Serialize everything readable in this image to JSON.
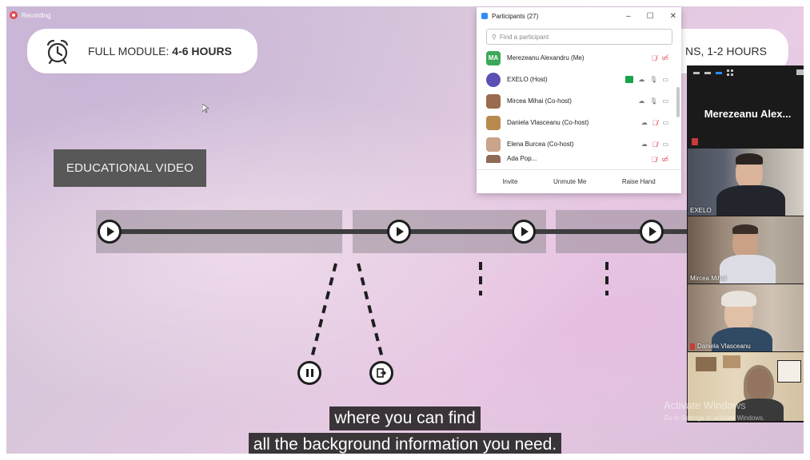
{
  "recording": {
    "label": "Recording"
  },
  "slide": {
    "pill_left": {
      "prefix": "FULL MODULE:",
      "value": "4-6 HOURS"
    },
    "pill_right": {
      "text": "NS, 1-2 HOURS"
    },
    "edu_label": "EDUCATIONAL VIDEO"
  },
  "captions": {
    "line1": "where you can find",
    "line2": "all the background information you need."
  },
  "participants": {
    "title": "Participants (27)",
    "search_placeholder": "Find a participant",
    "rows": [
      {
        "initials": "MA",
        "name": "Merezeanu Alexandru (Me)",
        "avatar_color": "#3aa857",
        "mic": "muted",
        "video": "off"
      },
      {
        "initials": "",
        "name": "EXELO (Host)",
        "avatar_color": "#5b4fb3",
        "mic": "on",
        "video": "on",
        "sharing": true
      },
      {
        "initials": "",
        "name": "Mircea Mihai (Co-host)",
        "avatar_color": "#9a6b4e",
        "mic": "on",
        "video": "on"
      },
      {
        "initials": "",
        "name": "Daniela Vlasceanu (Co-host)",
        "avatar_color": "#b98a4e",
        "mic": "muted",
        "video": "on"
      },
      {
        "initials": "",
        "name": "Elena Burcea (Co-host)",
        "avatar_color": "#c9a38a",
        "mic": "muted",
        "video": "on"
      },
      {
        "initials": "",
        "name": "Ada Pop...",
        "avatar_color": "#8f6a57",
        "mic": "muted",
        "video": "off"
      }
    ],
    "buttons": {
      "invite": "Invite",
      "unmute": "Unmute Me",
      "raise": "Raise Hand"
    },
    "accent": "#2d8cff",
    "muted_color": "#e0383e"
  },
  "gallery": {
    "self_name": "Merezeanu  Alex...",
    "tiles": [
      {
        "label": "EXELO",
        "muted": false
      },
      {
        "label": "Mircea Mihai",
        "muted": false
      },
      {
        "label": "Daniela Vlasceanu",
        "muted": true
      },
      {
        "label": "",
        "muted": false
      }
    ]
  },
  "watermark": {
    "line1": "Activate Windows",
    "line2": "Go to Settings to activate Windows."
  }
}
